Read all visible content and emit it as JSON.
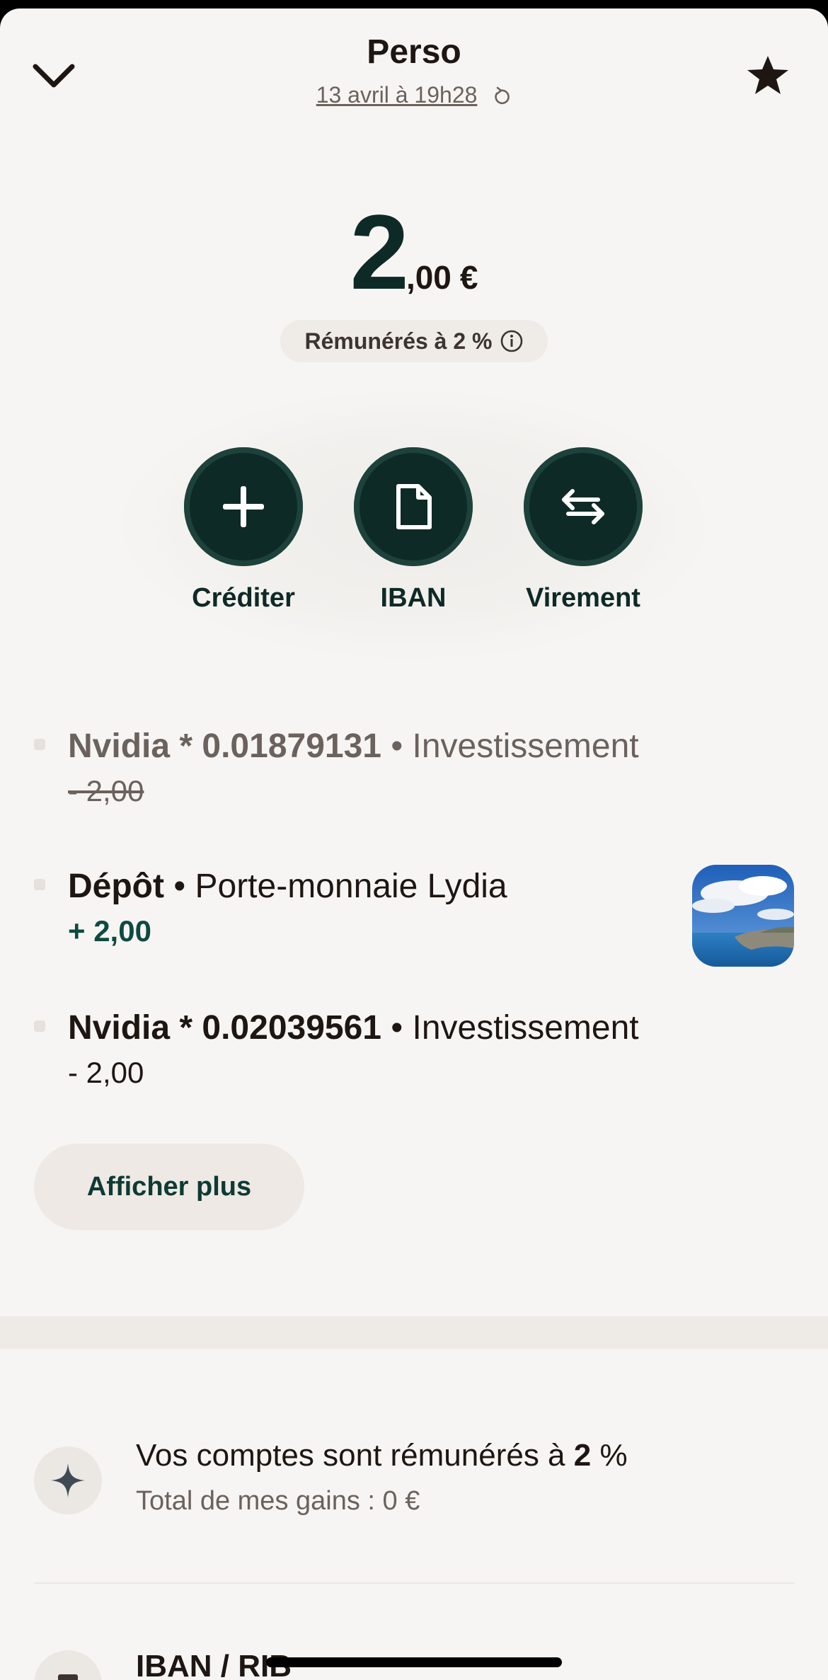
{
  "header": {
    "title": "Perso",
    "date": "13 avril à 19h28"
  },
  "balance": {
    "integer": "2",
    "decimal": ",00",
    "currency": "€"
  },
  "rate_badge": "Rémunérés à 2 %",
  "actions": [
    {
      "label": "Créditer",
      "icon": "plus-icon"
    },
    {
      "label": "IBAN",
      "icon": "document-icon"
    },
    {
      "label": "Virement",
      "icon": "transfer-arrows-icon"
    }
  ],
  "transactions": [
    {
      "name": "Nvidia * 0.01879131",
      "category": "Investissement",
      "amount": "- 2,00",
      "state": "cancelled"
    },
    {
      "name": "Dépôt",
      "category": "Porte-monnaie Lydia",
      "amount": "+ 2,00",
      "state": "credit"
    },
    {
      "name": "Nvidia * 0.02039561",
      "category": "Investissement",
      "amount": "- 2,00",
      "state": "debit"
    }
  ],
  "separator": "•",
  "show_more_label": "Afficher plus",
  "rate_feature": {
    "title_prefix": "Vos comptes sont rémunérés à ",
    "title_rate": "2",
    "title_suffix": " %",
    "subtitle": "Total de mes gains : 0 €"
  },
  "iban_row": {
    "label": "IBAN / RIB"
  },
  "colors": {
    "background": "#f7f5f3",
    "accent_dark_green": "#0e2a26",
    "credit_green": "#0e4a42",
    "muted_text": "#6b625d"
  }
}
